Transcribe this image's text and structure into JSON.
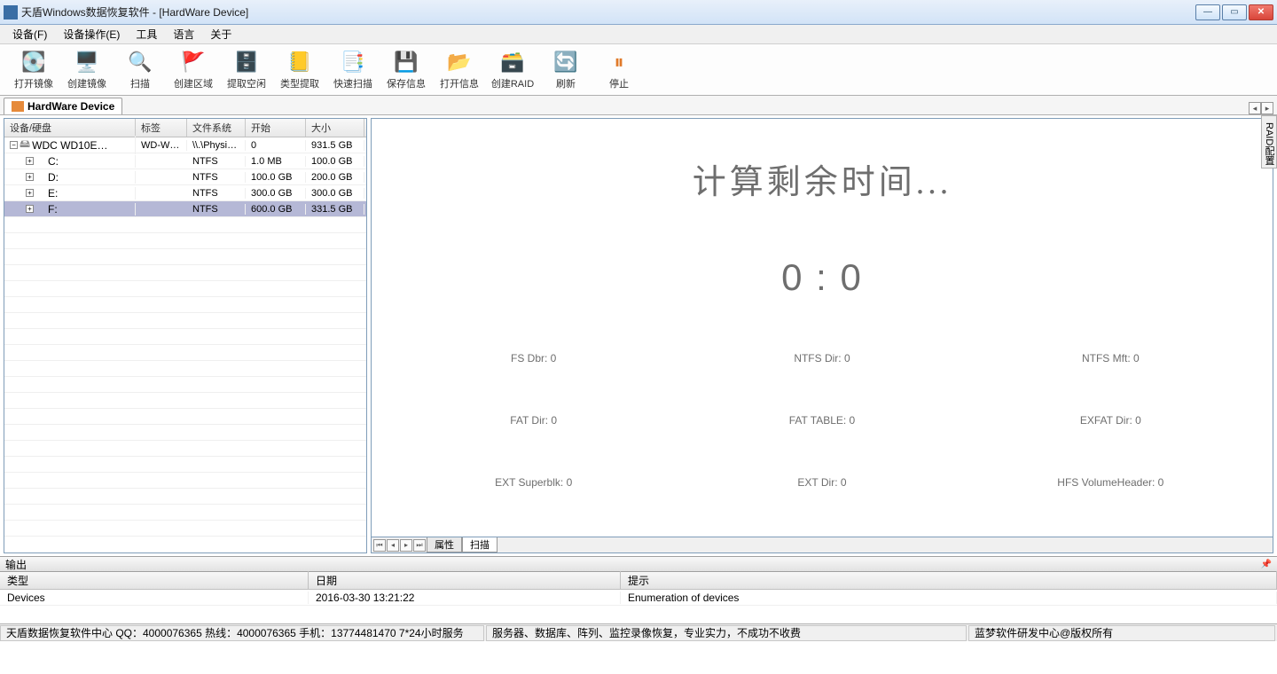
{
  "window": {
    "title": "天盾Windows数据恢复软件 - [HardWare Device]"
  },
  "menus": {
    "m1": "设备(F)",
    "m2": "设备操作(E)",
    "m3": "工具",
    "m4": "语言",
    "m5": "关于"
  },
  "toolbar": {
    "open_image": "打开镜像",
    "create_image": "创建镜像",
    "scan": "扫描",
    "create_region": "创建区域",
    "extract_space": "提取空闲",
    "type_extract": "类型提取",
    "quick_scan": "快速扫描",
    "save_info": "保存信息",
    "open_info": "打开信息",
    "create_raid": "创建RAID",
    "refresh": "刷新",
    "stop": "停止"
  },
  "doctab": {
    "label": "HardWare Device"
  },
  "tree": {
    "headers": {
      "device": "设备/硬盘",
      "label": "标签",
      "fs": "文件系统",
      "start": "开始",
      "size": "大小"
    },
    "rows": [
      {
        "indent": 0,
        "expander": "−",
        "icon": "🖴",
        "device": "WDC WD10E…",
        "label": "WD-WC…",
        "fs": "\\\\.\\Physi…",
        "start": "0",
        "size": "931.5 GB",
        "sel": false
      },
      {
        "indent": 1,
        "expander": "+",
        "icon": "",
        "device": "C:",
        "label": "",
        "fs": "NTFS",
        "start": "1.0 MB",
        "size": "100.0 GB",
        "sel": false
      },
      {
        "indent": 1,
        "expander": "+",
        "icon": "",
        "device": "D:",
        "label": "",
        "fs": "NTFS",
        "start": "100.0 GB",
        "size": "200.0 GB",
        "sel": false
      },
      {
        "indent": 1,
        "expander": "+",
        "icon": "",
        "device": "E:",
        "label": "",
        "fs": "NTFS",
        "start": "300.0 GB",
        "size": "300.0 GB",
        "sel": false
      },
      {
        "indent": 1,
        "expander": "+",
        "icon": "",
        "device": "F:",
        "label": "",
        "fs": "NTFS",
        "start": "600.0 GB",
        "size": "331.5 GB",
        "sel": true
      }
    ]
  },
  "scan": {
    "title": "计算剩余时间...",
    "time": "0  :  0",
    "stats": {
      "fs_dbr": "FS   Dbr: 0",
      "ntfs_dir": "NTFS Dir: 0",
      "ntfs_mft": "NTFS Mft: 0",
      "fat_dir": "FAT  Dir: 0",
      "fat_table": "FAT TABLE: 0",
      "exfat_dir": "EXFAT Dir: 0",
      "ext_sb": "EXT Superblk: 0",
      "ext_dir": "EXT Dir: 0",
      "hfs_vh": "HFS VolumeHeader: 0"
    }
  },
  "minitabs": {
    "t1": "属性",
    "t2": "扫描"
  },
  "side": {
    "raid": "RAID配置"
  },
  "output": {
    "header": "输出",
    "cols": {
      "type": "类型",
      "date": "日期",
      "hint": "提示"
    },
    "rows": [
      {
        "type": "Devices",
        "date": "2016-03-30 13:21:22",
        "hint": "Enumeration of devices"
      }
    ]
  },
  "status": {
    "left": "天盾数据恢复软件中心 QQ：4000076365 热线：4000076365 手机：13774481470   7*24小时服务",
    "mid": "服务器、数据库、阵列、监控录像恢复，专业实力，不成功不收费",
    "right": "蓝梦软件研发中心@版权所有"
  }
}
